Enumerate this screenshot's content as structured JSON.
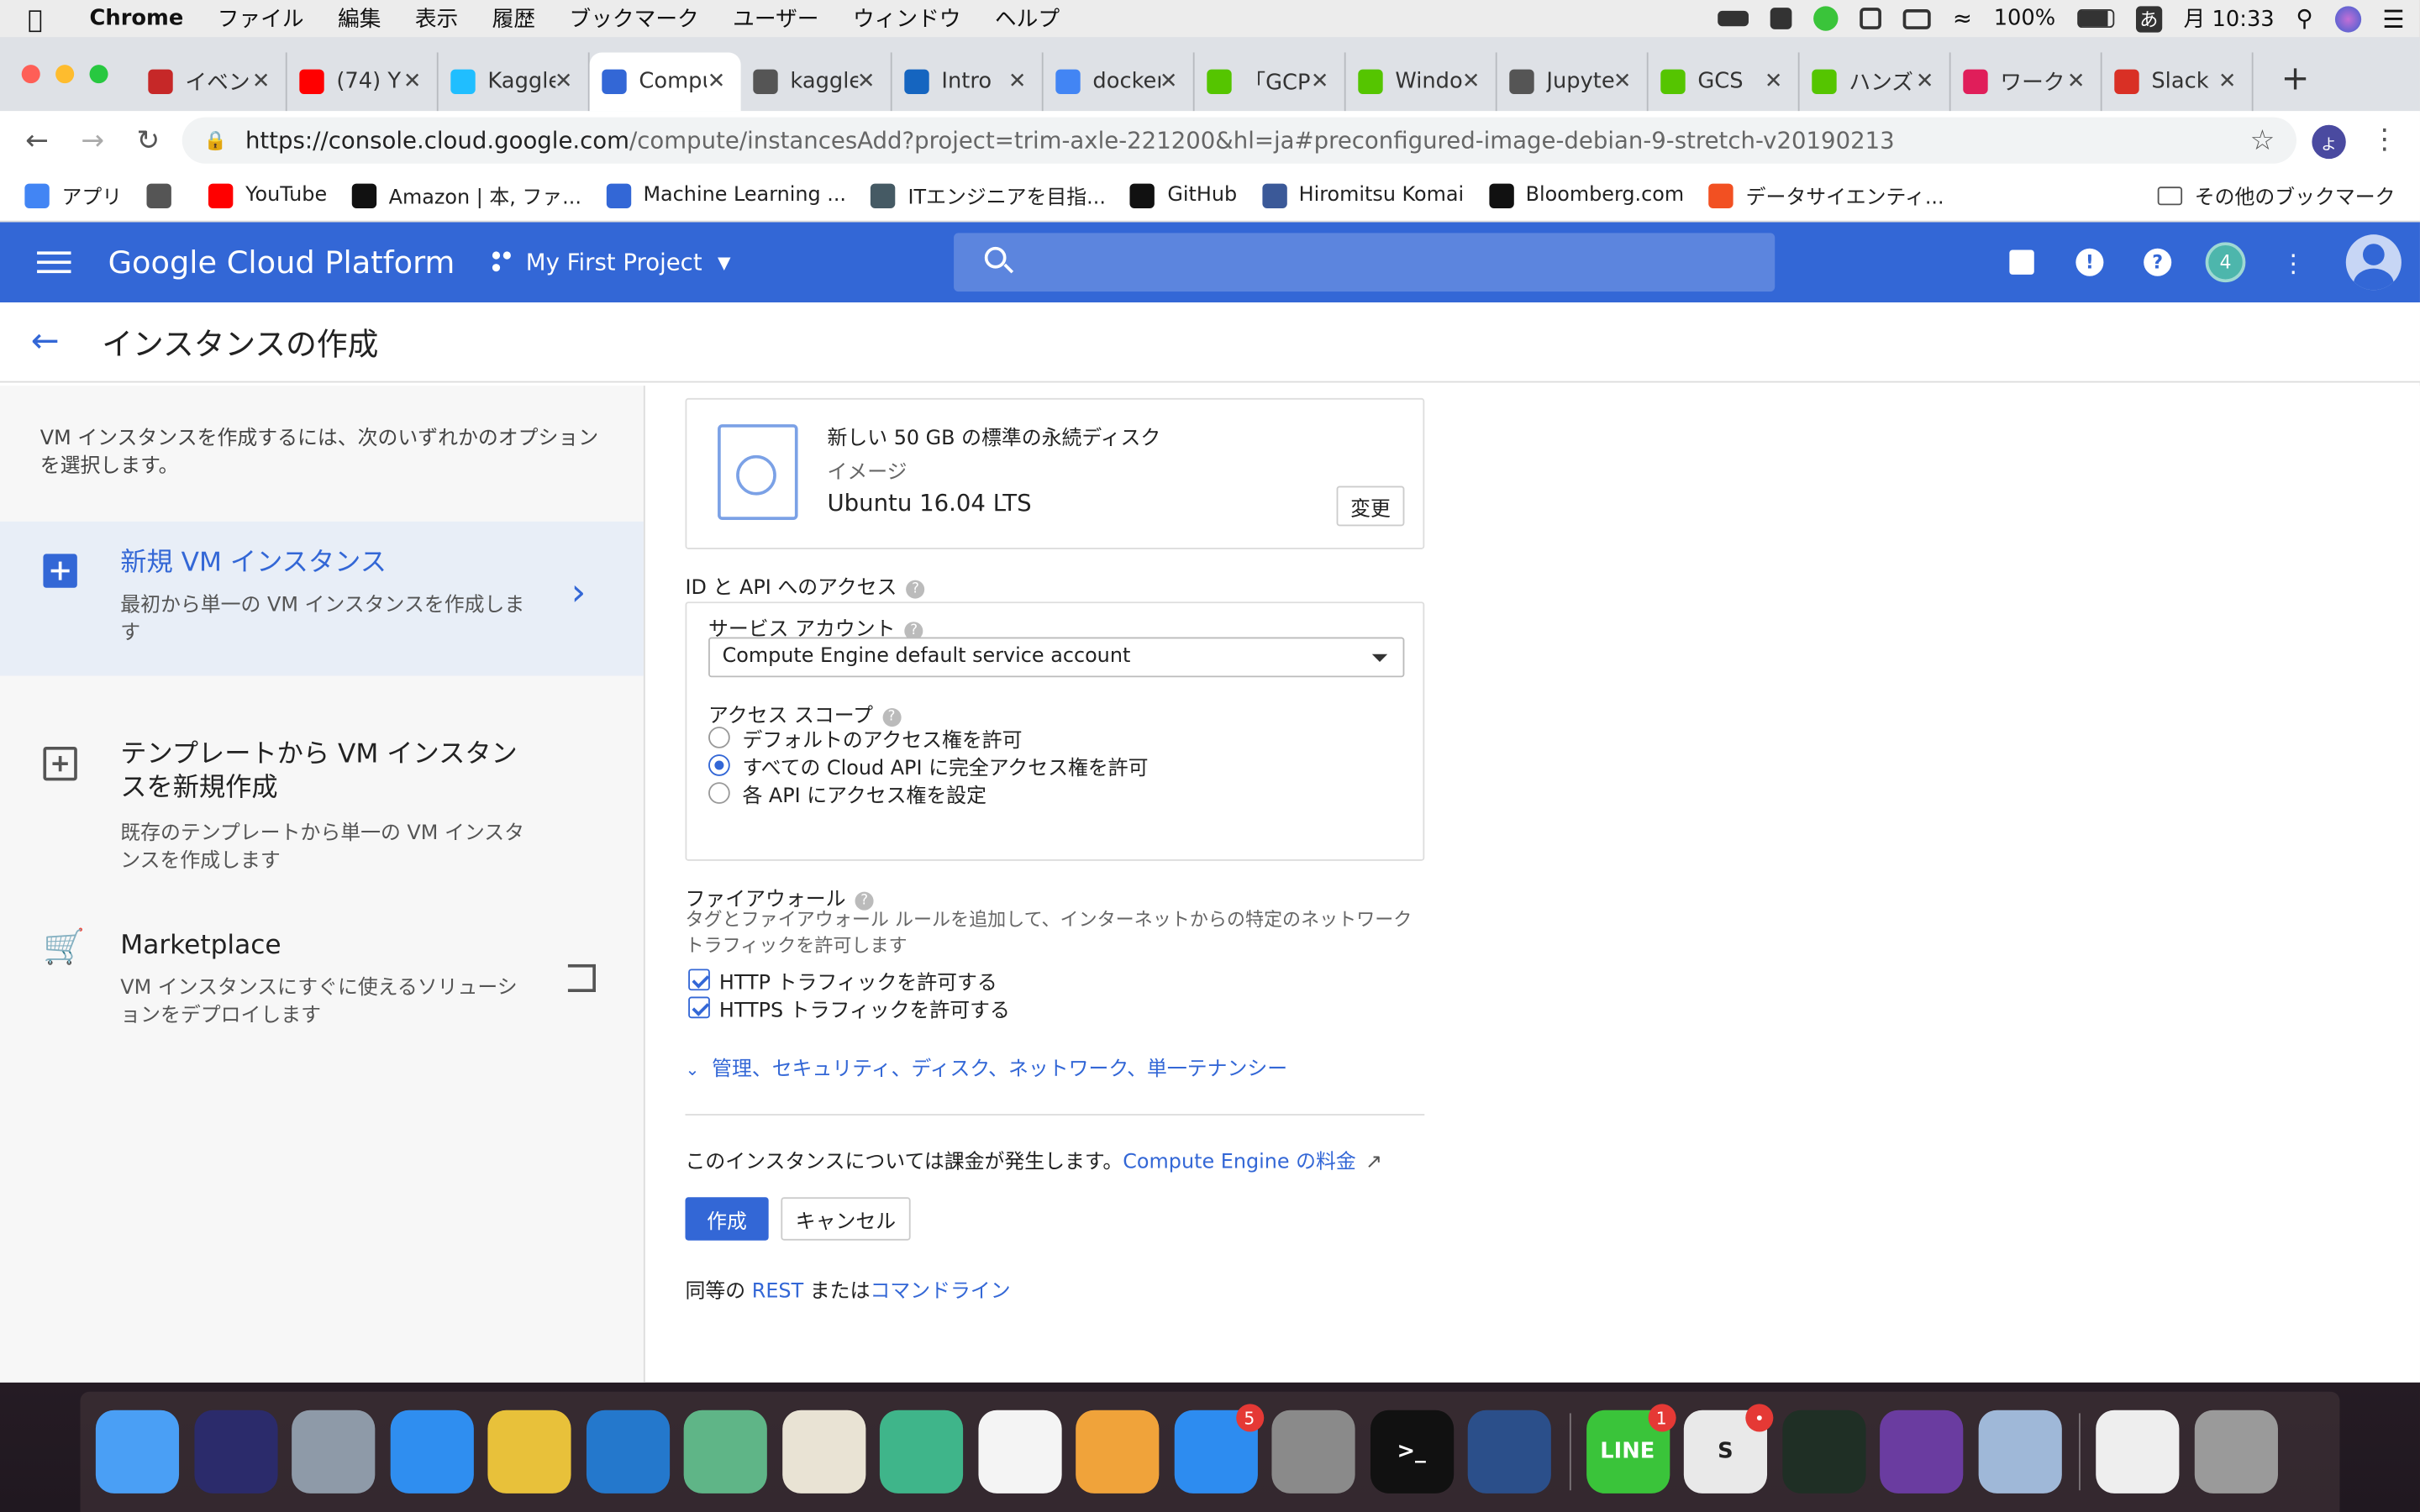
{
  "menubar": {
    "app": "Chrome",
    "items": [
      "ファイル",
      "編集",
      "表示",
      "履歴",
      "ブックマーク",
      "ユーザー",
      "ウィンドウ",
      "ヘルプ"
    ],
    "battery": "100%",
    "ime": "あ",
    "clock": "月 10:33"
  },
  "tabs": [
    {
      "title": "イベント",
      "color": "#c62828",
      "icon": "event-icon"
    },
    {
      "title": "(74) Y",
      "color": "#ff0000",
      "icon": "youtube-icon"
    },
    {
      "title": "Kaggle",
      "color": "#20beff",
      "icon": "kaggle-icon"
    },
    {
      "title": "Compute",
      "color": "#3367d6",
      "icon": "gcp-icon",
      "active": true
    },
    {
      "title": "kaggle",
      "color": "#555555",
      "icon": "kaggle-icon"
    },
    {
      "title": "Intro",
      "color": "#1565c0",
      "icon": "k-icon"
    },
    {
      "title": "docker",
      "color": "#4285f4",
      "icon": "google-icon"
    },
    {
      "title": "「GCP",
      "color": "#55c500",
      "icon": "qiita-icon"
    },
    {
      "title": "Windows",
      "color": "#55c500",
      "icon": "qiita-icon"
    },
    {
      "title": "Jupyter",
      "color": "#555555",
      "icon": "jupyter-icon"
    },
    {
      "title": "GCS",
      "color": "#55c500",
      "icon": "qiita-icon"
    },
    {
      "title": "ハンズ",
      "color": "#55c500",
      "icon": "qiita-icon"
    },
    {
      "title": "ワーク",
      "color": "#e01e5a",
      "icon": "slack-icon"
    },
    {
      "title": "Slack",
      "color": "#d93025",
      "icon": "gmail-icon"
    }
  ],
  "omnibox": {
    "host": "https://console.cloud.google.com",
    "path": "/compute/instancesAdd?project=trim-axle-221200&hl=ja#preconfigured-image-debian-9-stretch-v20190213",
    "profile": "よ"
  },
  "bookmarks": [
    {
      "label": "アプリ",
      "icon": "apps-grid-icon",
      "color": "#4285f4"
    },
    {
      "label": "",
      "icon": "folder-icon",
      "color": "#555555"
    },
    {
      "label": "YouTube",
      "icon": "youtube-icon",
      "color": "#ff0000"
    },
    {
      "label": "Amazon | 本, ファ...",
      "icon": "amazon-icon",
      "color": "#111111"
    },
    {
      "label": "Machine Learning ...",
      "icon": "ml-icon",
      "color": "#3367d6"
    },
    {
      "label": "ITエンジニアを目指...",
      "icon": "site-icon",
      "color": "#455a64"
    },
    {
      "label": "GitHub",
      "icon": "github-icon",
      "color": "#111111"
    },
    {
      "label": "Hiromitsu Komai",
      "icon": "facebook-icon",
      "color": "#3b5998"
    },
    {
      "label": "Bloomberg.com",
      "icon": "bloomberg-icon",
      "color": "#111111"
    },
    {
      "label": "データサイエンティ...",
      "icon": "microsoft-icon",
      "color": "#f25022"
    }
  ],
  "bookmarks_other": "その他のブックマーク",
  "gcp": {
    "logo": "Google Cloud Platform",
    "project": "My First Project",
    "notification_count": "4"
  },
  "page": {
    "title": "インスタンスの作成"
  },
  "left_panel": {
    "intro": "VM インスタンスを作成するには、次のいずれかのオプションを選択します。",
    "options": [
      {
        "title": "新規 VM インスタンス",
        "desc": "最初から単一の VM インスタンスを作成します"
      },
      {
        "title": "テンプレートから VM インスタンスを新規作成",
        "desc": "既存のテンプレートから単一の VM インスタンスを作成します"
      },
      {
        "title": "Marketplace",
        "desc": "VM インスタンスにすぐに使えるソリューションをデプロイします"
      }
    ]
  },
  "boot_disk": {
    "title": "新しい 50 GB の標準の永続ディスク",
    "image_label": "イメージ",
    "image": "Ubuntu 16.04 LTS",
    "change": "変更"
  },
  "identity": {
    "heading": "ID と API へのアクセス",
    "service_account_label": "サービス アカウント",
    "service_account": "Compute Engine default service account",
    "scope_label": "アクセス スコープ",
    "scopes": [
      {
        "label": "デフォルトのアクセス権を許可",
        "selected": false
      },
      {
        "label": "すべての Cloud API に完全アクセス権を許可",
        "selected": true
      },
      {
        "label": "各 API にアクセス権を設定",
        "selected": false
      }
    ]
  },
  "firewall": {
    "heading": "ファイアウォール",
    "desc": "タグとファイアウォール ルールを追加して、インターネットからの特定のネットワーク トラフィックを許可します",
    "http": "HTTP トラフィックを許可する",
    "https": "HTTPS トラフィックを許可する",
    "http_checked": true,
    "https_checked": true
  },
  "advanced_link": "管理、セキュリティ、ディスク、ネットワーク、単一テナンシー",
  "billing": {
    "text": "このインスタンスについては課金が発生します。",
    "link": "Compute Engine の料金"
  },
  "actions": {
    "create": "作成",
    "cancel": "キャンセル"
  },
  "equivalent": {
    "prefix": "同等の",
    "rest": "REST",
    "or": "または",
    "cli": "コマンドライン"
  },
  "dock": [
    {
      "name": "finder",
      "color": "#4a9ff5",
      "label": ""
    },
    {
      "name": "siri",
      "color": "#2b2b6b",
      "label": ""
    },
    {
      "name": "launchpad",
      "color": "#8e9aa8",
      "label": ""
    },
    {
      "name": "safari",
      "color": "#2f8ef0",
      "label": ""
    },
    {
      "name": "chrome",
      "color": "#e8c13a",
      "label": ""
    },
    {
      "name": "vscode",
      "color": "#2478cc",
      "label": ""
    },
    {
      "name": "atom",
      "color": "#5fb587",
      "label": ""
    },
    {
      "name": "maps",
      "color": "#e9e3d4",
      "label": ""
    },
    {
      "name": "telegram",
      "color": "#3fb58a",
      "label": ""
    },
    {
      "name": "photos",
      "color": "#f4f4f4",
      "label": ""
    },
    {
      "name": "pages",
      "color": "#f0a33a",
      "label": ""
    },
    {
      "name": "appstore",
      "color": "#2d8cf0",
      "label": "",
      "badge": "5"
    },
    {
      "name": "system-preferences",
      "color": "#8a8a8a",
      "label": ""
    },
    {
      "name": "terminal",
      "color": "#111111",
      "label": ">_"
    },
    {
      "name": "kindle",
      "color": "#2b4f8a",
      "label": ""
    },
    {
      "name": "line",
      "color": "#3ac43a",
      "label": "LINE",
      "badge": "1"
    },
    {
      "name": "slack",
      "color": "#e9e9e9",
      "label": "S",
      "badge": "•"
    },
    {
      "name": "activity-monitor",
      "color": "#1f2f25",
      "label": ""
    },
    {
      "name": "sqlpro",
      "color": "#6a3ca0",
      "label": ""
    },
    {
      "name": "preview",
      "color": "#9fb8d8",
      "label": ""
    },
    {
      "name": "downloads",
      "color": "#eeeeee",
      "label": ""
    },
    {
      "name": "trash",
      "color": "#9a9a9a",
      "label": ""
    }
  ]
}
